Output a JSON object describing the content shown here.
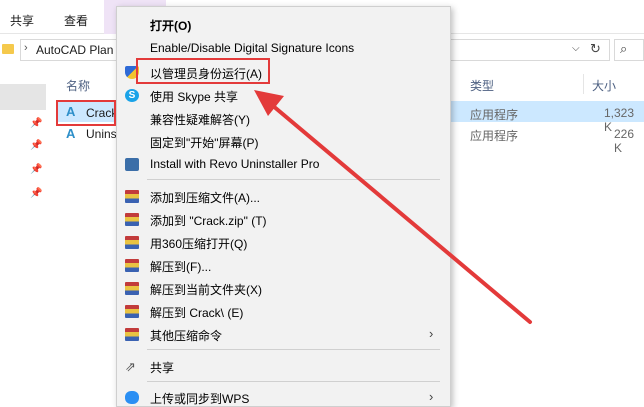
{
  "ribbon": {
    "tabs": [
      "共享",
      "查看"
    ]
  },
  "address_bar": {
    "path": "AutoCAD Plan"
  },
  "columns": {
    "name": "名称",
    "type": "类型",
    "size": "大小"
  },
  "files": [
    {
      "name": "Crack",
      "type": "应用程序",
      "size": "1,323 K",
      "selected": true
    },
    {
      "name": "Unins",
      "type": "应用程序",
      "size": "226 K",
      "selected": false
    }
  ],
  "context_menu": {
    "items": [
      {
        "label": "打开(O)",
        "bold": true,
        "icon": "none"
      },
      {
        "label": "Enable/Disable Digital Signature Icons",
        "icon": "none"
      },
      {
        "label": "以管理员身份运行(A)",
        "icon": "uac-shield-icon",
        "highlighted": true
      },
      {
        "label": "使用 Skype 共享",
        "icon": "skype-icon"
      },
      {
        "label": "兼容性疑难解答(Y)",
        "icon": "none"
      },
      {
        "label": "固定到\"开始\"屏幕(P)",
        "icon": "none"
      },
      {
        "label": "Install with Revo Uninstaller Pro",
        "icon": "revo-icon"
      },
      {
        "label": "添加到压缩文件(A)...",
        "icon": "winrar-icon"
      },
      {
        "label": "添加到 \"Crack.zip\" (T)",
        "icon": "winrar-icon"
      },
      {
        "label": "用360压缩打开(Q)",
        "icon": "winrar-icon"
      },
      {
        "label": "解压到(F)...",
        "icon": "winrar-icon"
      },
      {
        "label": "解压到当前文件夹(X)",
        "icon": "winrar-icon"
      },
      {
        "label": "解压到 Crack\\ (E)",
        "icon": "winrar-icon"
      },
      {
        "label": "其他压缩命令",
        "icon": "winrar-icon",
        "submenu": true
      },
      {
        "label": "共享",
        "icon": "share-icon"
      },
      {
        "label": "上传或同步到WPS",
        "icon": "wps-cloud-icon",
        "submenu": true
      }
    ]
  },
  "annotation": {
    "color": "#e33a3a"
  }
}
